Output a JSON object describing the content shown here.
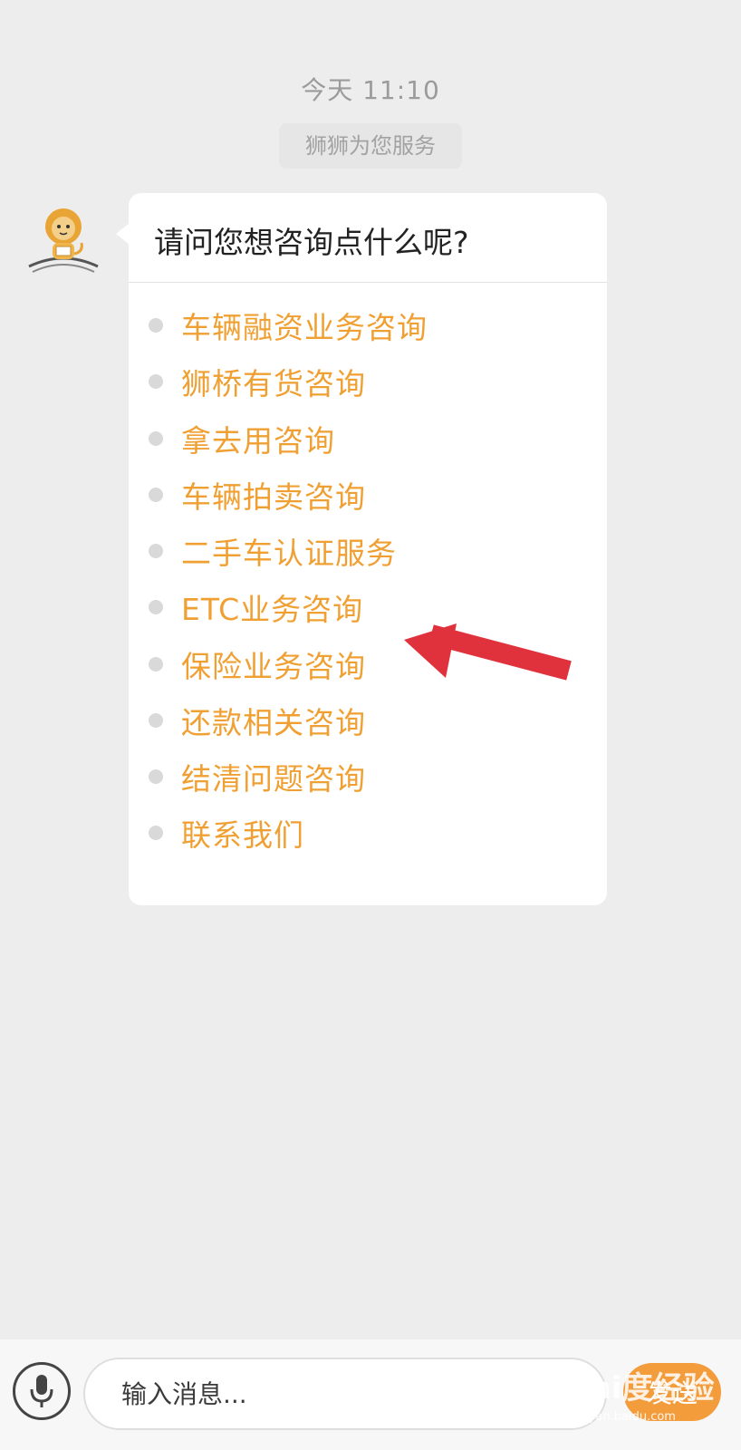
{
  "chat": {
    "timestamp": "今天 11:10",
    "system_notice": "狮狮为您服务"
  },
  "bot_message": {
    "question": "请问您想咨询点什么呢?",
    "options": [
      "车辆融资业务咨询",
      "狮桥有货咨询",
      "拿去用咨询",
      "车辆拍卖咨询",
      "二手车认证服务",
      "ETC业务咨询",
      "保险业务咨询",
      "还款相关咨询",
      "结清问题咨询",
      "联系我们"
    ]
  },
  "input_bar": {
    "placeholder": "输入消息...",
    "send_label": "发送"
  },
  "watermark": {
    "main": "Bai度经验",
    "sub": "jingyan.baidu.com"
  },
  "colors": {
    "background": "#ededed",
    "option_text": "#f0a033",
    "send_button": "#f39c3c",
    "annotation_arrow": "#e0323c"
  }
}
